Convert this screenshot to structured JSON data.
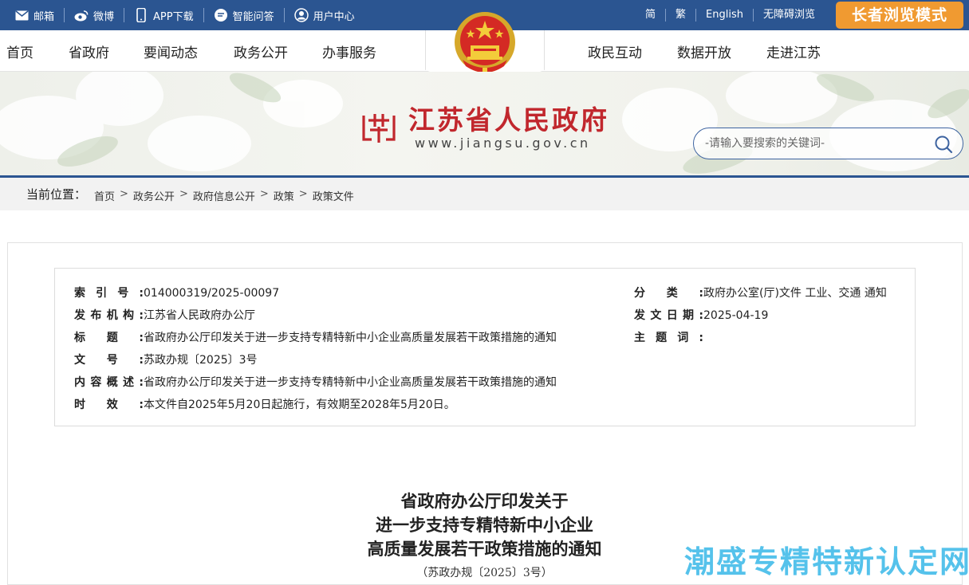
{
  "topbar": {
    "links": [
      {
        "label": "邮箱",
        "icon": "mail-icon"
      },
      {
        "label": "微博",
        "icon": "weibo-icon"
      },
      {
        "label": "APP下载",
        "icon": "phone-icon"
      },
      {
        "label": "智能问答",
        "icon": "chat-icon"
      },
      {
        "label": "用户中心",
        "icon": "user-icon"
      }
    ],
    "right": [
      "简",
      "繁",
      "English",
      "无障碍浏览"
    ],
    "elder_mode": "长者浏览模式"
  },
  "nav": {
    "left": [
      "首页",
      "省政府",
      "要闻动态",
      "政务公开",
      "办事服务"
    ],
    "right": [
      "政民互动",
      "数据开放",
      "走进江苏"
    ]
  },
  "banner": {
    "site_name": "江苏省人民政府",
    "site_url": "www.jiangsu.gov.cn",
    "search_placeholder": "-请输入要搜索的关键词-"
  },
  "breadcrumb": {
    "label": "当前位置：",
    "items": [
      "首页",
      "政务公开",
      "政府信息公开",
      "政策",
      "政策文件"
    ],
    "separator": ">"
  },
  "meta": {
    "index_no_key": "索引号:",
    "index_no": "014000319/2025-00097",
    "category_key": "分类:",
    "category": "政府办公室(厅)文件 工业、交通 通知",
    "issuer_key": "发布机构:",
    "issuer": "江苏省人民政府办公厅",
    "date_key": "发文日期:",
    "date": "2025-04-19",
    "title_key": "标题:",
    "title": "省政府办公厅印发关于进一步支持专精特新中小企业高质量发展若干政策措施的通知",
    "keywords_key": "主题词:",
    "keywords": "",
    "doc_no_key": "文号:",
    "doc_no": "苏政办规〔2025〕3号",
    "summary_key": "内容概述:",
    "summary": "省政府办公厅印发关于进一步支持专精特新中小企业高质量发展若干政策措施的通知",
    "validity_key": "时效:",
    "validity": "本文件自2025年5月20日起施行，有效期至2028年5月20日。"
  },
  "document": {
    "title_lines": [
      "省政府办公厅印发关于",
      "进一步支持专精特新中小企业",
      "高质量发展若干政策措施的通知"
    ],
    "doc_no": "（苏政办规〔2025〕3号）"
  },
  "watermark": "潮盛专精特新认定网",
  "colors": {
    "topbar": "#2b5591",
    "elder_button": "#f09a31",
    "site_name": "#c1272d",
    "watermark": "#38b8e8"
  }
}
